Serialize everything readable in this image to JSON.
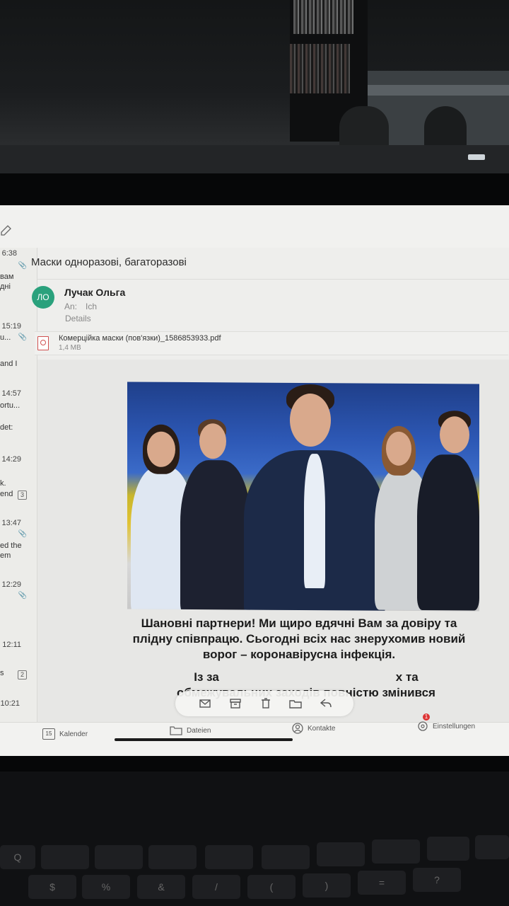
{
  "mail_list": [
    {
      "time": "6:38",
      "snippet": [
        "вам",
        "дні"
      ],
      "clip": true
    },
    {
      "time": "15:19",
      "snippet": [
        "u..."
      ],
      "clip": true
    },
    {
      "time": "",
      "snippet": [
        "and I"
      ],
      "clip": false
    },
    {
      "time": "14:57",
      "snippet": [
        "ortu...",
        "det:"
      ],
      "clip": false
    },
    {
      "time": "14:29",
      "snippet": [
        "k.",
        "end"
      ],
      "badge": "3"
    },
    {
      "time": "13:47",
      "snippet": [
        "ed the",
        "em"
      ],
      "clip": true
    },
    {
      "time": "12:29",
      "snippet": [],
      "clip": true
    },
    {
      "time": "12:11",
      "snippet": [
        "s"
      ],
      "badge": "2"
    },
    {
      "time": "10:21",
      "snippet": [],
      "clip": false
    }
  ],
  "email": {
    "subject": "Маски одноразові, багаторазові",
    "avatar_initials": "ЛО",
    "sender": "Лучак Ольга",
    "to_label": "An:",
    "to_value": "Ich",
    "details_label": "Details",
    "attachment_name": "Комерційка маски (пов'язки)_1586853933.pdf",
    "attachment_size": "1,4 MB",
    "body_line1": "Шановні партнери! Ми щиро вдячні Вам за довіру та плідну співпрацю. Сьогодні всіх нас знерухомив  новий ворог – коронавірусна інфекція.",
    "body_line2_start": "Із за",
    "body_line2_end": "х та",
    "body_line3": "обмежувальних заходів повністю змінився"
  },
  "toolbar": [
    "mail-icon",
    "archive-icon",
    "trash-icon",
    "folder-icon",
    "reply-icon"
  ],
  "tabs": {
    "calendar_num": "15",
    "calendar": "Kalender",
    "files": "Dateien",
    "contacts": "Kontakte",
    "settings": "Einstellungen",
    "settings_badge": "1"
  },
  "keyboard_keys": [
    "Q",
    "",
    "",
    "",
    "",
    "",
    "",
    "",
    "",
    "",
    "$",
    "%",
    "&",
    "/",
    "(",
    ")",
    "=",
    "?"
  ],
  "colors": {
    "avatar": "#2aa17c",
    "notification": "#dd3333"
  }
}
